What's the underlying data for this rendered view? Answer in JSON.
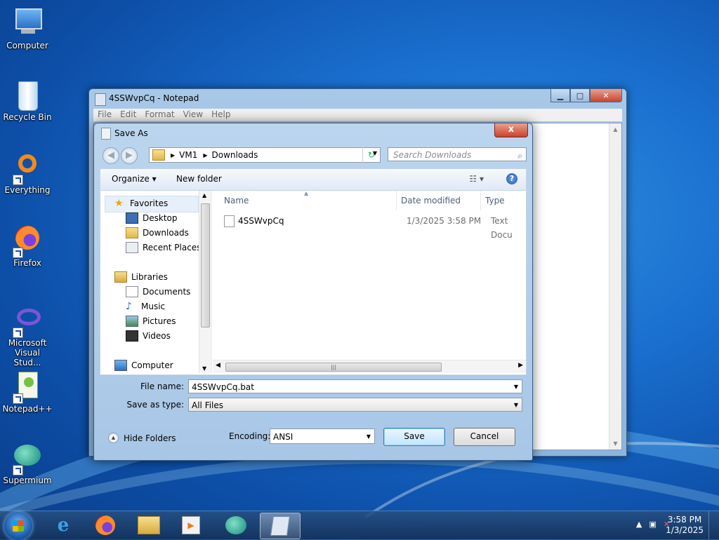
{
  "desktop": {
    "icons": [
      {
        "label": "Computer"
      },
      {
        "label": "Recycle Bin"
      },
      {
        "label": "Everything"
      },
      {
        "label": "Firefox"
      },
      {
        "label": "Microsoft Visual Stud..."
      },
      {
        "label": "Notepad++"
      },
      {
        "label": "Supermium"
      }
    ]
  },
  "notepad": {
    "title": "4SSWvpCq - Notepad",
    "menu": [
      "File",
      "Edit",
      "Format",
      "View",
      "Help"
    ]
  },
  "dialog": {
    "title": "Save As",
    "close": "x",
    "breadcrumb": [
      "VM1",
      "Downloads"
    ],
    "search_placeholder": "Search Downloads",
    "toolbar": {
      "organize": "Organize ▾",
      "new_folder": "New folder"
    },
    "nav": {
      "favorites": "Favorites",
      "desktop": "Desktop",
      "downloads": "Downloads",
      "recent": "Recent Places",
      "libraries": "Libraries",
      "documents": "Documents",
      "music": "Music",
      "pictures": "Pictures",
      "videos": "Videos",
      "computer": "Computer"
    },
    "columns": {
      "name": "Name",
      "date": "Date modified",
      "type": "Type"
    },
    "files": [
      {
        "name": "4SSWvpCq",
        "date": "1/3/2025 3:58 PM",
        "type": "Text Docu"
      }
    ],
    "filename_label": "File name:",
    "filename_value": "4SSWvpCq.bat",
    "savetype_label": "Save as type:",
    "savetype_value": "All Files",
    "hide_folders": "Hide Folders",
    "encoding_label": "Encoding:",
    "encoding_value": "ANSI",
    "save": "Save",
    "cancel": "Cancel"
  },
  "taskbar": {
    "time": "3:58 PM",
    "date": "1/3/2025"
  }
}
